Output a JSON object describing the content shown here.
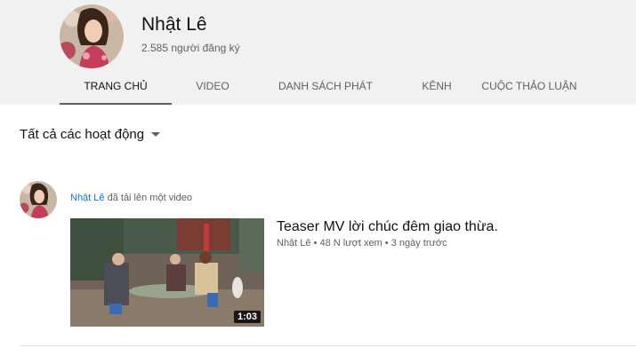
{
  "channel": {
    "name": "Nhật Lê",
    "subscribers": "2.585 người đăng ký"
  },
  "tabs": [
    {
      "label": "TRANG CHỦ",
      "active": true
    },
    {
      "label": "VIDEO",
      "active": false
    },
    {
      "label": "DANH SÁCH PHÁT",
      "active": false
    },
    {
      "label": "KÊNH",
      "active": false
    },
    {
      "label": "CUỘC THẢO LUẬN",
      "active": false
    }
  ],
  "filter": {
    "label": "Tất cả các hoạt động",
    "icon": "caret-down-icon"
  },
  "feed": {
    "author": "Nhật Lê",
    "action": "đã tải lên một video",
    "video": {
      "title": "Teaser MV lời chúc đêm giao thừa.",
      "channel": "Nhật Lê",
      "views": "48 N lượt xem",
      "age": "3 ngày trước",
      "separator": "•",
      "duration": "1:03"
    }
  },
  "colors": {
    "header_bg": "#f1f1f1",
    "link_blue": "#1a73c8",
    "secondary_text": "#606060"
  }
}
